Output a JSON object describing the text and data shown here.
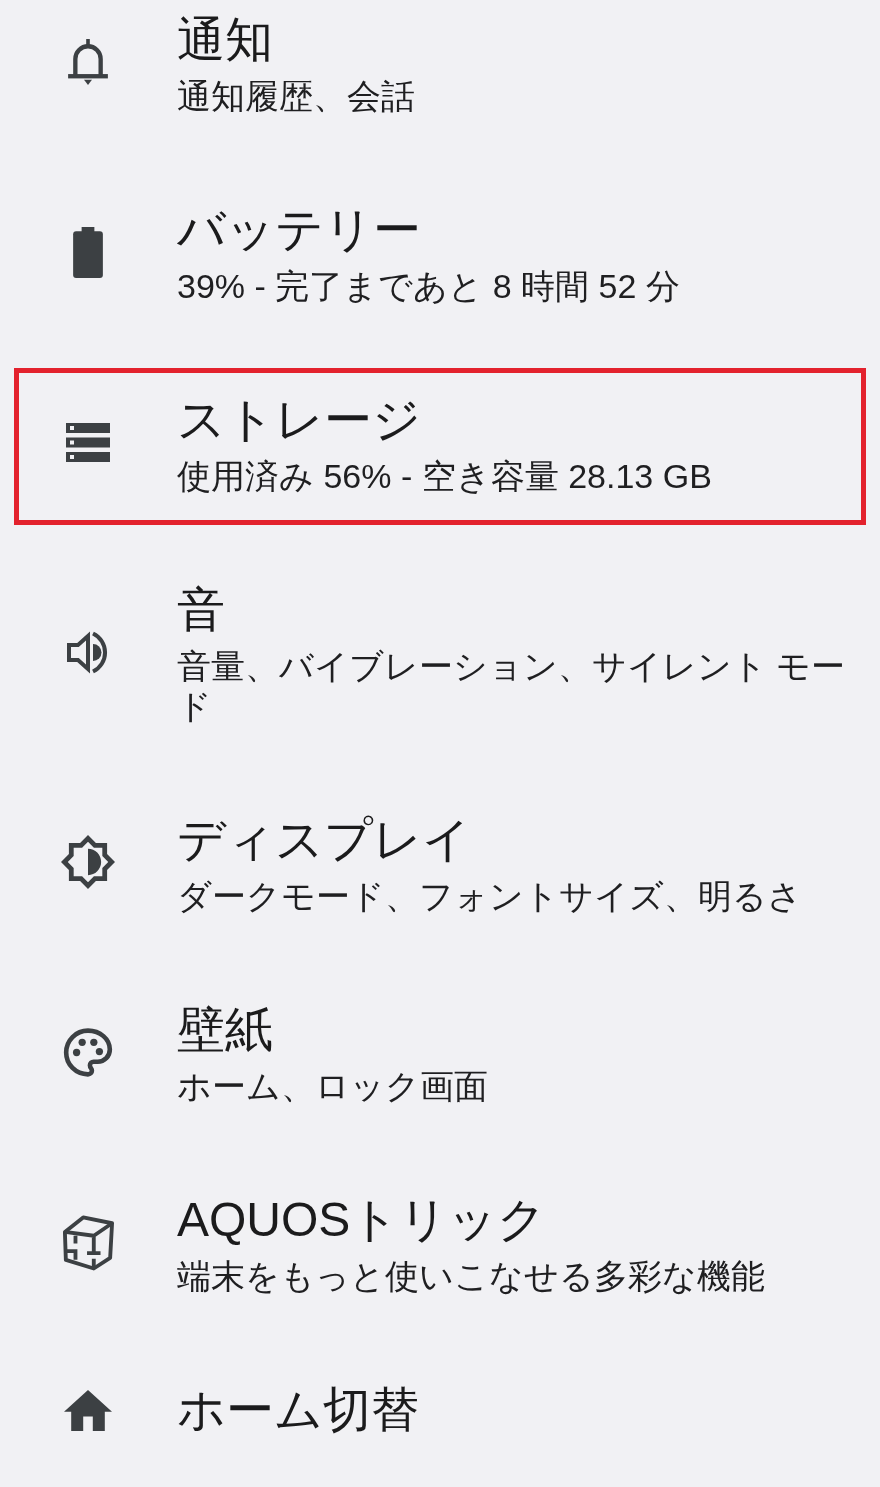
{
  "items": [
    {
      "title": "通知",
      "subtitle": "通知履歴、会話",
      "highlighted": false
    },
    {
      "title": "バッテリー",
      "subtitle": "39% - 完了まであと 8 時間 52 分",
      "highlighted": false
    },
    {
      "title": "ストレージ",
      "subtitle": "使用済み 56% - 空き容量 28.13 GB",
      "highlighted": true
    },
    {
      "title": "音",
      "subtitle": "音量、バイブレーション、サイレント モード",
      "highlighted": false
    },
    {
      "title": "ディスプレイ",
      "subtitle": "ダークモード、フォントサイズ、明るさ",
      "highlighted": false
    },
    {
      "title": "壁紙",
      "subtitle": "ホーム、ロック画面",
      "highlighted": false
    },
    {
      "title": "AQUOSトリック",
      "subtitle": "端末をもっと使いこなせる多彩な機能",
      "highlighted": false
    },
    {
      "title": "ホーム切替",
      "highlighted": false
    }
  ]
}
